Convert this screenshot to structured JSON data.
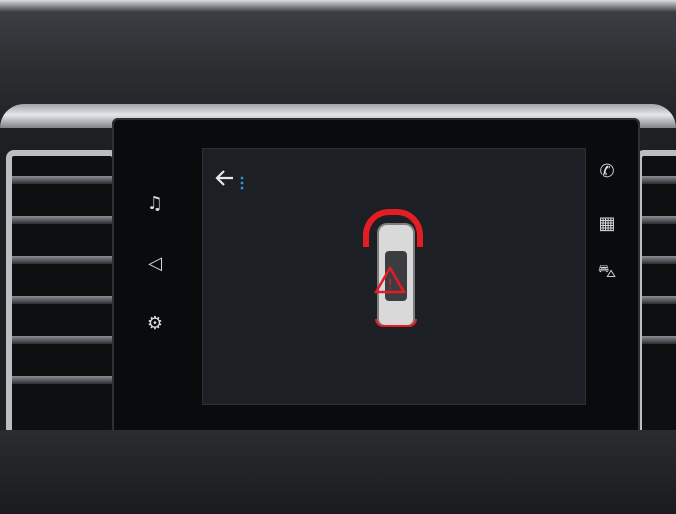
{
  "screen": {
    "back_icon": "back-arrow-icon",
    "menu_icon": "vertical-dots-icon"
  },
  "left_controls": [
    {
      "name": "music",
      "icon": "music-note-icon",
      "glyph": "♫"
    },
    {
      "name": "navigation",
      "icon": "navigation-arrow-icon",
      "glyph": "◁"
    },
    {
      "name": "apps",
      "icon": "apps-grid-icon",
      "glyph": "⚙"
    }
  ],
  "right_controls": [
    {
      "name": "phone",
      "icon": "phone-icon",
      "glyph": "✆"
    },
    {
      "name": "applications",
      "icon": "grid-icon",
      "glyph": "▦"
    },
    {
      "name": "vehicle",
      "icon": "car-icon",
      "glyph": "⛍"
    }
  ],
  "parking_sensor": {
    "front_zone_color": "#e41c23",
    "rear_zone_color": "#e41c23",
    "warning_icon": "warning-triangle-icon",
    "warning_glyph": "!"
  }
}
